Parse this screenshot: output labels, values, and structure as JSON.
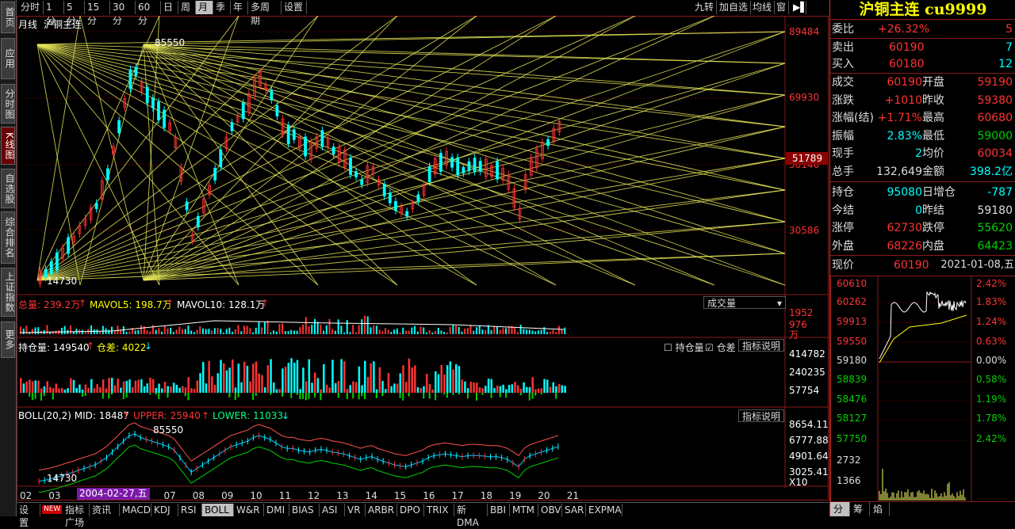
{
  "left_tabs": [
    {
      "label": "首页",
      "active": false
    },
    {
      "label": "应用",
      "active": false
    },
    {
      "label": "分时图",
      "active": false
    },
    {
      "label": "K线图",
      "active": true
    },
    {
      "label": "自选股",
      "active": false
    },
    {
      "label": "综合排名",
      "active": false
    },
    {
      "label": "上证指数",
      "active": false
    },
    {
      "label": "更多",
      "active": false
    }
  ],
  "period_tabs": [
    "分时",
    "1分",
    "5分",
    "15分",
    "30分",
    "60分",
    "日",
    "周",
    "月",
    "季",
    "年",
    "多周期",
    "设置"
  ],
  "period_active": "月",
  "toolbar_right": [
    "九转",
    "加自选",
    "均线",
    "窗"
  ],
  "chart": {
    "period_label": "月线",
    "symbol_label": "沪铜主连",
    "high_marker": "85550",
    "low_marker": "14730",
    "price_axis": [
      "89484",
      "69930",
      "51789",
      "50146",
      "30586"
    ],
    "current_price_tag": "51789",
    "volume_legend": {
      "total": "总量: 239.2万",
      "mavol5": "MAVOL5: 198.7万",
      "mavol10": "MAVOL10: 128.1万"
    },
    "volume_selector": "成交量",
    "volume_axis": [
      "1952",
      "976",
      "万"
    ],
    "oi_legend": {
      "oi": "持仓量: 149540",
      "diff": "仓差: 4022"
    },
    "oi_checkboxes": [
      "持仓量",
      "仓差"
    ],
    "oi_explain": "指标说明",
    "oi_axis": [
      "414782",
      "240235",
      "57754"
    ],
    "boll_legend": {
      "mid": "BOLL(20,2) MID: 18487",
      "upper": "UPPER: 25940",
      "lower": "LOWER: 11033"
    },
    "boll_explain": "指标说明",
    "boll_axis": [
      "8654.11",
      "6777.88",
      "4901.64",
      "3025.41",
      "X10"
    ],
    "boll_high": "85550",
    "boll_low": "14730",
    "x_axis": [
      "02",
      "03",
      "04",
      "05",
      "06",
      "07",
      "08",
      "09",
      "10",
      "11",
      "12",
      "13",
      "14",
      "15",
      "16",
      "17",
      "18",
      "19",
      "20",
      "21"
    ],
    "date_cursor": "2004-02-27,五"
  },
  "bottom_tabs": [
    "设置",
    "指标广场",
    "资讯",
    "MACD",
    "KDJ",
    "RSI",
    "BOLL",
    "W&R",
    "DMI",
    "BIAS",
    "ASI",
    "VR",
    "ARBR",
    "DPO",
    "TRIX",
    "新DMA",
    "BBI",
    "MTM",
    "OBV",
    "SAR",
    "EXPMA"
  ],
  "bottom_new_badge": "NEW",
  "bottom_active": "BOLL",
  "quote": {
    "title": "沪铜主连 cu9999",
    "weibi": {
      "label": "委比",
      "value": "+26.32%",
      "num": "5"
    },
    "sell": {
      "label": "卖出",
      "value": "60190",
      "num": "7"
    },
    "buy": {
      "label": "买入",
      "value": "60180",
      "num": "12"
    },
    "rows": [
      {
        "l1": "成交",
        "v1": "60190",
        "l2": "开盘",
        "v2": "59190"
      },
      {
        "l1": "涨跌",
        "v1": "+1010",
        "l2": "昨收",
        "v2": "59380"
      },
      {
        "l1": "涨幅(结)",
        "v1": "+1.71%",
        "l2": "最高",
        "v2": "60680"
      },
      {
        "l1": "振幅",
        "v1": "2.83%",
        "l2": "最低",
        "v2": "59000"
      },
      {
        "l1": "现手",
        "v1": "2",
        "l2": "均价",
        "v2": "60034"
      },
      {
        "l1": "总手",
        "v1": "132,649",
        "l2": "金额",
        "v2": "398.2亿"
      },
      {
        "l1": "持仓",
        "v1": "95080",
        "l2": "日增仓",
        "v2": "-787"
      },
      {
        "l1": "今结",
        "v1": "0",
        "l2": "昨结",
        "v2": "59180"
      },
      {
        "l1": "涨停",
        "v1": "62730",
        "l2": "跌停",
        "v2": "55620"
      },
      {
        "l1": "外盘",
        "v1": "68226",
        "l2": "内盘",
        "v2": "64423"
      }
    ],
    "now_label": "现价",
    "now_value": "60190",
    "now_date": "2021-01-08,五",
    "mini_left": [
      "60610",
      "60262",
      "59913",
      "59550",
      "59180",
      "58839",
      "58476",
      "58127",
      "57750",
      "2732",
      "1366"
    ],
    "mini_right": [
      "2.42%",
      "1.83%",
      "1.24%",
      "0.63%",
      "0.00%",
      "0.58%",
      "1.19%",
      "1.78%",
      "2.42%"
    ]
  },
  "right_tabs": [
    "分",
    "筹",
    "焰"
  ],
  "right_active": "分"
}
